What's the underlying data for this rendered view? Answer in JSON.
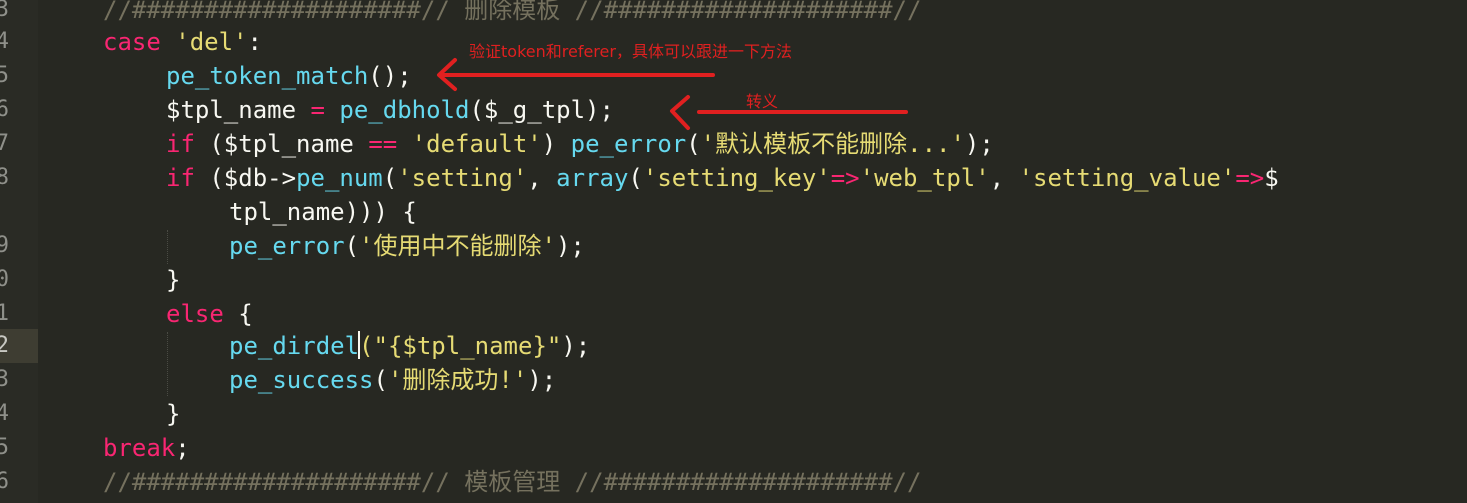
{
  "gutter": {
    "line_numbers": [
      "3",
      "4",
      "5",
      "6",
      "7",
      "8",
      "",
      "9",
      "0",
      "1",
      "2",
      "3",
      "4",
      "5",
      "6"
    ]
  },
  "code": {
    "l1_comment": "//####################// 删除模板 //####################//",
    "l2_case": "case",
    "l2_str": "'del'",
    "l2_colon": ":",
    "l3_fn": "pe_token_match",
    "l3_rest": "();",
    "l4_var": "$tpl_name",
    "l4_eq": "=",
    "l4_fn": "pe_dbhold",
    "l4_rest": "($_g_tpl);",
    "l5_if": "if",
    "l5_a": "($tpl_name",
    "l5_eq": "==",
    "l5_str": "'default'",
    "l5_b": ")",
    "l5_fn": "pe_error",
    "l5_p": "(",
    "l5_msg": "'默认模板不能删除...'",
    "l5_end": ");",
    "l6_if": "if",
    "l6_a": "($db->",
    "l6_fn": "pe_num",
    "l6_p": "(",
    "l6_s1": "'setting'",
    "l6_comma": ",",
    "l6_fn2": "array",
    "l6_p2": "(",
    "l6_s2": "'setting_key'",
    "l6_arrow": "=>",
    "l6_s3": "'web_tpl'",
    "l6_comma2": ",",
    "l6_s4": "'setting_value'",
    "l6_arrow2": "=>",
    "l6_end": "$",
    "l7_text": "tpl_name))) {",
    "l8_fn": "pe_error",
    "l8_p": "(",
    "l8_msg": "'使用中不能删除'",
    "l8_end": ");",
    "l9_brace": "}",
    "l10_else": "else",
    "l10_brace": "{",
    "l11_fn": "pe_dirdel",
    "l11_str": "(\"{$tpl_name}\"",
    "l11_end": ");",
    "l12_fn": "pe_success",
    "l12_p": "(",
    "l12_msg": "'删除成功!'",
    "l12_end": ");",
    "l13_brace": "}",
    "l14_break": "break",
    "l14_semi": ";",
    "l15_comment": "//####################// 模板管理 //####################//"
  },
  "annotations": {
    "token_note": "验证token和referer，具体可以跟进一下方法",
    "escape_note": "转义"
  },
  "colors": {
    "background": "#272822",
    "keyword": "#f92672",
    "string": "#e6db74",
    "function": "#66d9ef",
    "comment": "#75715e",
    "annotation": "#e02020"
  }
}
